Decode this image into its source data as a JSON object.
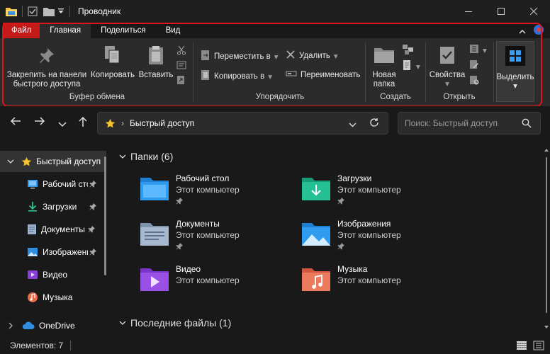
{
  "window": {
    "title": "Проводник"
  },
  "ribbon_tabs": [
    "Файл",
    "Главная",
    "Поделиться",
    "Вид"
  ],
  "ribbon": {
    "clipboard": {
      "pin_label": "Закрепить на панели быстрого доступа",
      "pin_line1": "Закрепить на панели",
      "pin_line2": "быстрого доступа",
      "copy_label": "Копировать",
      "paste_label": "Вставить",
      "group_label": "Буфер обмена"
    },
    "organize": {
      "move_label": "Переместить в",
      "copy_to_label": "Копировать в",
      "delete_label": "Удалить",
      "rename_label": "Переименовать",
      "group_label": "Упорядочить"
    },
    "create": {
      "new_folder_line1": "Новая",
      "new_folder_line2": "папка",
      "group_label": "Создать"
    },
    "open": {
      "properties_label": "Свойства",
      "group_label": "Открыть"
    },
    "select": {
      "select_label": "Выделить"
    }
  },
  "address": {
    "path": "Быстрый доступ",
    "search_placeholder": "Поиск: Быстрый доступ"
  },
  "sidebar": {
    "items": [
      {
        "label": "Быстрый доступ",
        "icon": "star-icon"
      },
      {
        "label": "Рабочий стол",
        "icon": "desktop-icon"
      },
      {
        "label": "Загрузки",
        "icon": "download-icon"
      },
      {
        "label": "Документы",
        "icon": "document-icon"
      },
      {
        "label": "Изображения",
        "icon": "image-icon"
      },
      {
        "label": "Видео",
        "icon": "video-icon"
      },
      {
        "label": "Музыка",
        "icon": "music-icon"
      },
      {
        "label": "OneDrive",
        "icon": "cloud-icon"
      }
    ]
  },
  "main": {
    "folders_header": "Папки (6)",
    "recent_header": "Последние файлы (1)",
    "folders": [
      {
        "name": "Рабочий стол",
        "location": "Этот компьютер",
        "pinned": true
      },
      {
        "name": "Загрузки",
        "location": "Этот компьютер",
        "pinned": true
      },
      {
        "name": "Документы",
        "location": "Этот компьютер",
        "pinned": true
      },
      {
        "name": "Изображения",
        "location": "Этот компьютер",
        "pinned": true
      },
      {
        "name": "Видео",
        "location": "Этот компьютер",
        "pinned": false
      },
      {
        "name": "Музыка",
        "location": "Этот компьютер",
        "pinned": false
      }
    ]
  },
  "status": {
    "items_count": "Элементов: 7"
  },
  "colors": {
    "accent_red": "#e0141b",
    "file_tab": "#c41a1a",
    "background": "#191919",
    "ribbon": "#2b2b2b"
  }
}
